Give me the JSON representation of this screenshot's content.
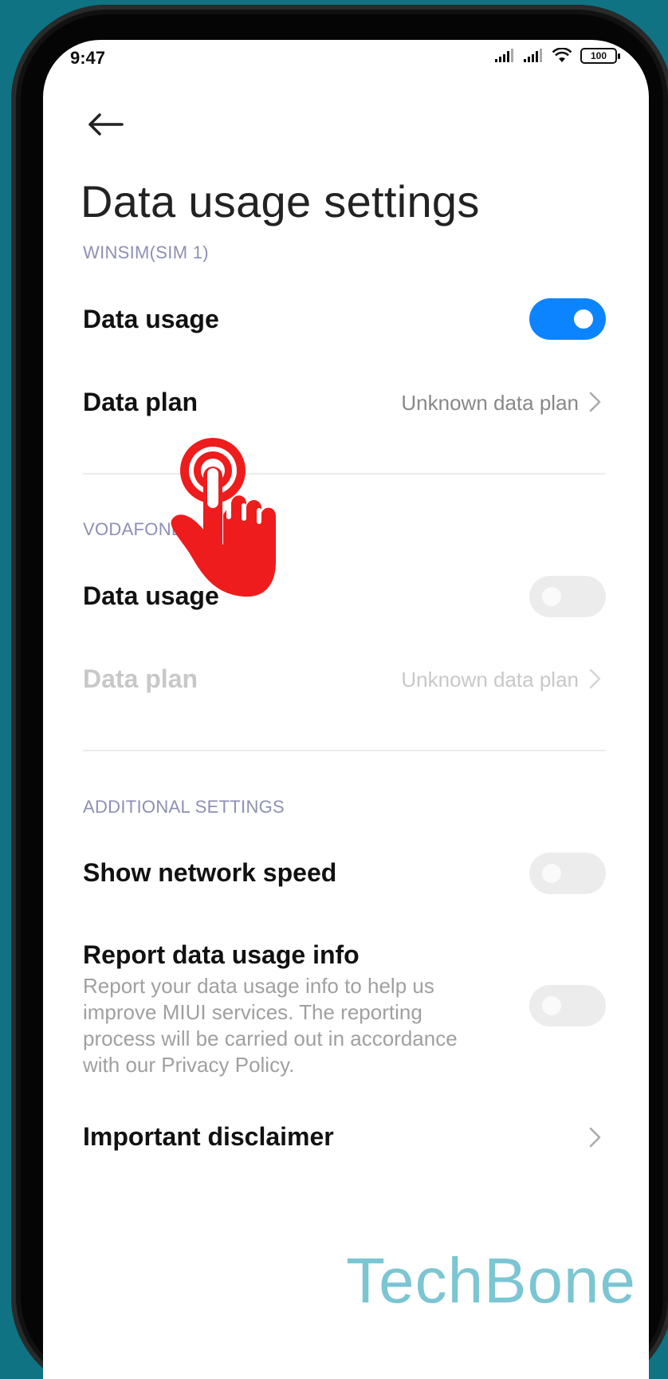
{
  "status_bar": {
    "time": "9:47",
    "battery": "100",
    "icons": [
      "signal-icon",
      "signal-icon",
      "wifi-icon",
      "battery-icon"
    ]
  },
  "header": {
    "back_icon": "back-arrow-icon",
    "title": "Data usage settings"
  },
  "sim1": {
    "header": "WINSIM(SIM 1)",
    "data_usage": {
      "label": "Data usage",
      "enabled": true
    },
    "data_plan": {
      "label": "Data plan",
      "value": "Unknown data plan"
    }
  },
  "sim2": {
    "header": "VODAFONE.D",
    "header_tail": "...)",
    "data_usage": {
      "label": "Data usage",
      "enabled": false
    },
    "data_plan": {
      "label": "Data plan",
      "value": "Unknown data plan",
      "disabled": true
    }
  },
  "additional": {
    "header": "ADDITIONAL SETTINGS",
    "show_speed": {
      "label": "Show network speed",
      "enabled": false
    },
    "report": {
      "label": "Report data usage info",
      "description": "Report your data usage info to help us improve MIUI services. The reporting process will be carried out in accordance with our Privacy Policy.",
      "enabled": false
    },
    "disclaimer": {
      "label": "Important disclaimer"
    }
  },
  "watermark": "TechBone",
  "colors": {
    "accent": "#0d84ff",
    "section": "#8d8fb6",
    "background": "#0f7383",
    "tap_indicator": "#ee1c1c",
    "watermark": "#7cc5d3"
  }
}
